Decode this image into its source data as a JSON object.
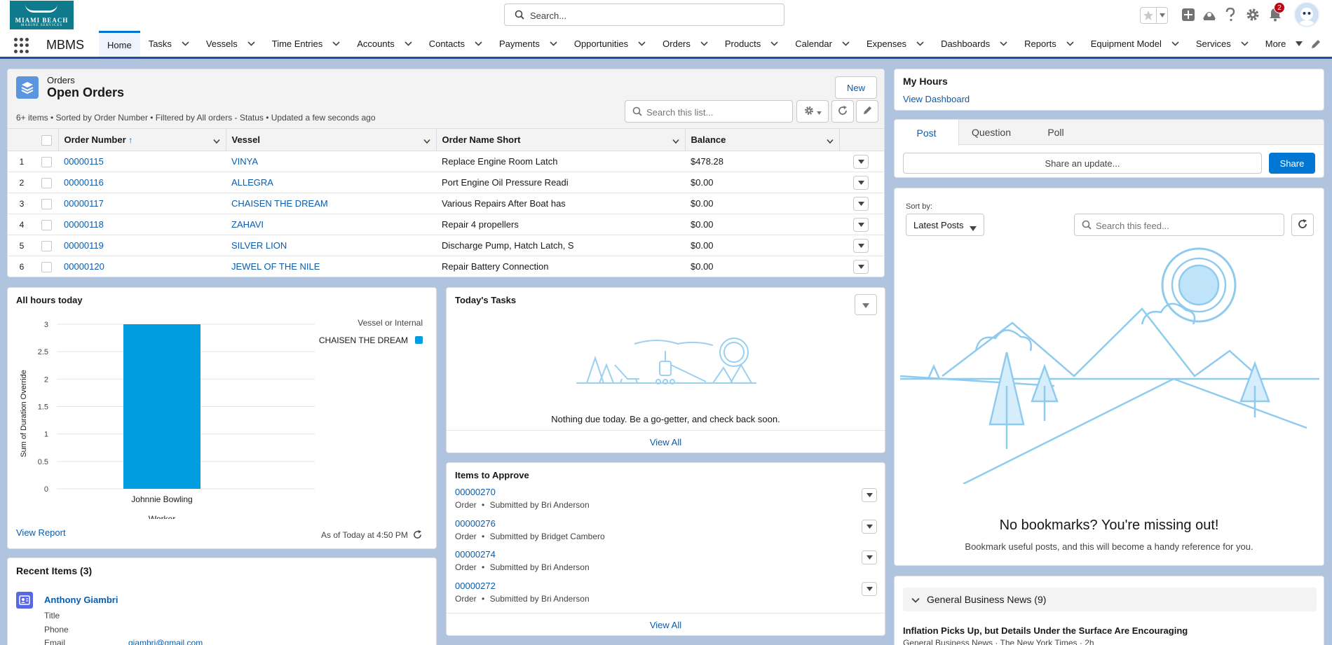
{
  "header": {
    "logo_line1": "MIAMI BEACH",
    "logo_line2": "MARINE SERVICES",
    "search_placeholder": "Search...",
    "notification_count": "2"
  },
  "nav": {
    "app_name": "MBMS",
    "items": [
      {
        "label": "Home",
        "active": true
      },
      {
        "label": "Tasks"
      },
      {
        "label": "Vessels"
      },
      {
        "label": "Time Entries"
      },
      {
        "label": "Accounts"
      },
      {
        "label": "Contacts"
      },
      {
        "label": "Payments"
      },
      {
        "label": "Opportunities"
      },
      {
        "label": "Orders"
      },
      {
        "label": "Products"
      },
      {
        "label": "Calendar"
      },
      {
        "label": "Expenses"
      },
      {
        "label": "Dashboards"
      },
      {
        "label": "Reports"
      },
      {
        "label": "Equipment Model"
      },
      {
        "label": "Services"
      },
      {
        "label": "More"
      }
    ]
  },
  "orders": {
    "object_label": "Orders",
    "list_title": "Open Orders",
    "new_label": "New",
    "summary": "6+ items • Sorted by Order Number • Filtered by All orders - Status • Updated a few seconds ago",
    "search_placeholder": "Search this list...",
    "columns": [
      "Order Number",
      "Vessel",
      "Order Name Short",
      "Balance"
    ],
    "sort_indicator": "↑",
    "rows": [
      {
        "n": "1",
        "order": "00000115",
        "vessel": "VINYA",
        "name": "Replace Engine Room Latch",
        "balance": "$478.28"
      },
      {
        "n": "2",
        "order": "00000116",
        "vessel": "ALLEGRA",
        "name": "Port Engine Oil Pressure Readi",
        "balance": "$0.00"
      },
      {
        "n": "3",
        "order": "00000117",
        "vessel": "CHAISEN THE DREAM",
        "name": "Various Repairs After Boat has",
        "balance": "$0.00"
      },
      {
        "n": "4",
        "order": "00000118",
        "vessel": "ZAHAVI",
        "name": "Repair 4 propellers",
        "balance": "$0.00"
      },
      {
        "n": "5",
        "order": "00000119",
        "vessel": "SILVER LION",
        "name": "Discharge Pump, Hatch Latch, S",
        "balance": "$0.00"
      },
      {
        "n": "6",
        "order": "00000120",
        "vessel": "JEWEL OF THE NILE",
        "name": "Repair Battery Connection",
        "balance": "$0.00"
      }
    ]
  },
  "hours_chart": {
    "title": "All hours today",
    "view_report": "View Report",
    "as_of": "As of Today at 4:50 PM",
    "legend_title": "Vessel or Internal",
    "legend_item": "CHAISEN THE DREAM",
    "bar_color": "#009ee0"
  },
  "chart_data": {
    "type": "bar",
    "title": "All hours today",
    "categories": [
      "Johnnie Bowling"
    ],
    "series": [
      {
        "name": "CHAISEN THE DREAM",
        "values": [
          3
        ]
      }
    ],
    "xlabel": "Worker",
    "ylabel": "Sum of Duration Override",
    "ylim": [
      0,
      3
    ],
    "yticks": [
      "3",
      "2.5",
      "2",
      "1.5",
      "1",
      "0.5",
      "0"
    ],
    "legend_title": "Vessel or Internal",
    "legend": "right"
  },
  "tasks": {
    "title": "Today's Tasks",
    "empty_text": "Nothing due today. Be a go-getter, and check back soon.",
    "view_all": "View All"
  },
  "approve": {
    "title": "Items to Approve",
    "items": [
      {
        "number": "00000270",
        "type": "Order",
        "submitted": "Submitted by Bri Anderson"
      },
      {
        "number": "00000276",
        "type": "Order",
        "submitted": "Submitted by Bridget Cambero"
      },
      {
        "number": "00000274",
        "type": "Order",
        "submitted": "Submitted by Bri Anderson"
      },
      {
        "number": "00000272",
        "type": "Order",
        "submitted": "Submitted by Bri Anderson"
      }
    ],
    "separator": "•",
    "view_all": "View All"
  },
  "recent": {
    "title": "Recent Items (3)",
    "name": "Anthony Giambri",
    "fields": [
      {
        "label": "Title",
        "value": ""
      },
      {
        "label": "Phone",
        "value": ""
      },
      {
        "label": "Email",
        "value": "giambri@gmail.com"
      }
    ]
  },
  "my_hours": {
    "title": "My Hours",
    "link": "View Dashboard"
  },
  "feed": {
    "tabs": [
      "Post",
      "Question",
      "Poll"
    ],
    "share_placeholder": "Share an update...",
    "share_label": "Share",
    "sort_by_label": "Sort by:",
    "sort_value": "Latest Posts",
    "search_placeholder": "Search this feed...",
    "empty_title": "No bookmarks? You're missing out!",
    "empty_text": "Bookmark useful posts, and this will become a handy reference for you."
  },
  "news": {
    "section_title": "General Business News (9)",
    "headline": "Inflation Picks Up, but Details Under the Surface Are Encouraging",
    "source": "General Business News · The New York Times · 2h"
  }
}
